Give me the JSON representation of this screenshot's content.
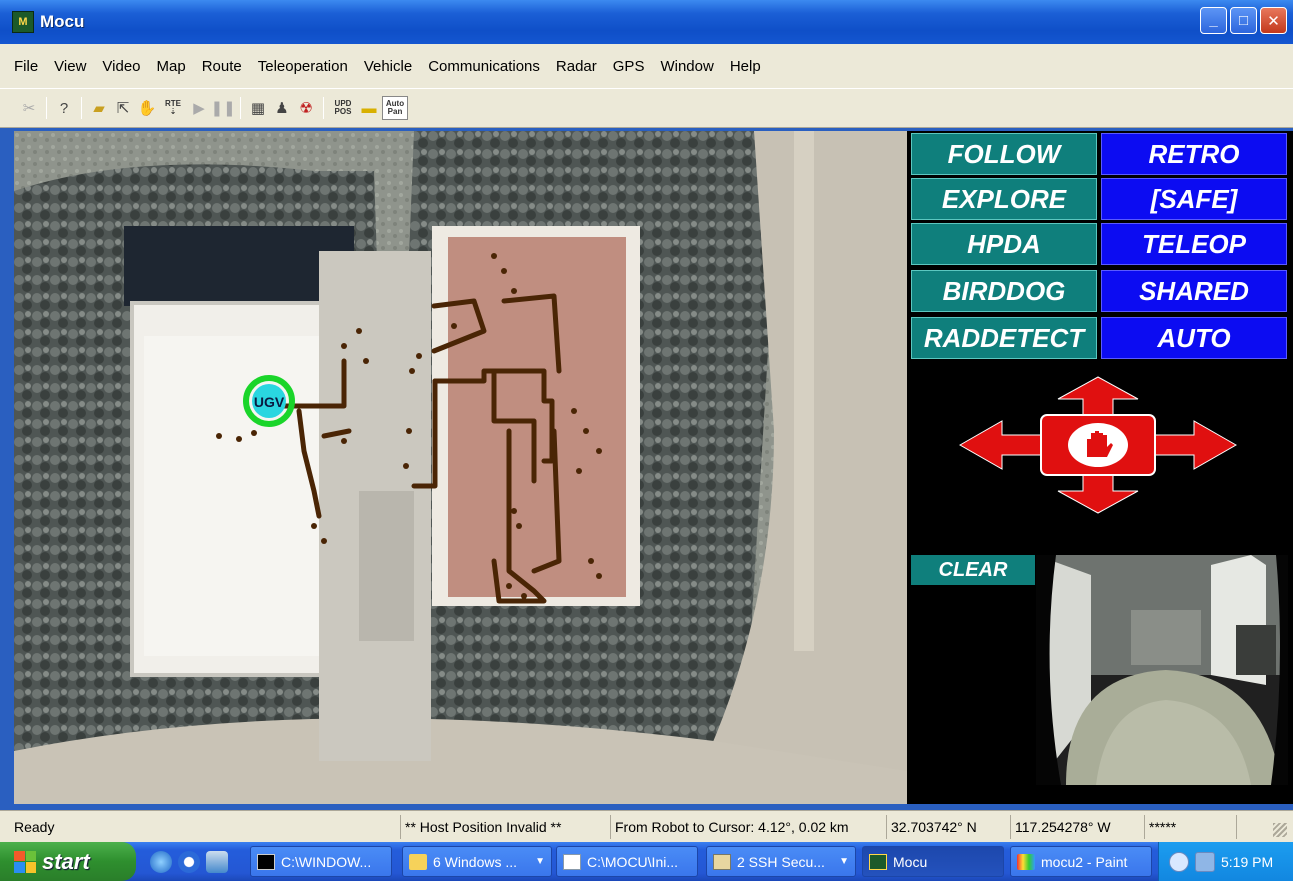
{
  "window": {
    "title": "Mocu",
    "app_icon_text": "M"
  },
  "menu": [
    "File",
    "View",
    "Video",
    "Map",
    "Route",
    "Teleoperation",
    "Vehicle",
    "Communications",
    "Radar",
    "GPS",
    "Window",
    "Help"
  ],
  "toolbar": {
    "rte_label": "RTE",
    "upd_label": "UPD",
    "pos_label": "POS",
    "auto_label": "Auto",
    "pan_label": "Pan"
  },
  "map": {
    "robot_label": "UGV"
  },
  "modes_left": [
    "FOLLOW",
    "EXPLORE",
    "HPDA",
    "BIRDDOG",
    "RADDETECT"
  ],
  "modes_right": [
    "RETRO",
    "[SAFE]",
    "TELEOP",
    "SHARED",
    "AUTO"
  ],
  "clear_label": "CLEAR",
  "status": {
    "ready": "Ready",
    "host": "** Host Position Invalid **",
    "robot_cursor": "From Robot to Cursor: 4.12°, 0.02 km",
    "lat": "32.703742° N",
    "lon": "117.254278° W",
    "stars": "*****"
  },
  "taskbar": {
    "start": "start",
    "tasks": [
      "C:\\WINDOW...",
      "6 Windows ...",
      "C:\\MOCU\\Ini...",
      "2 SSH Secu...",
      "Mocu",
      "mocu2 - Paint"
    ],
    "clock": "5:19 PM"
  },
  "colors": {
    "teal_mode": "#0f7f7c",
    "blue_mode": "#0c0cf2",
    "taskbar": "#245ddb",
    "start_green": "#2e8f2e"
  }
}
